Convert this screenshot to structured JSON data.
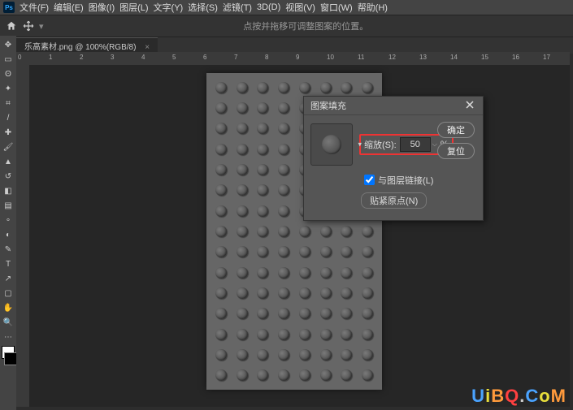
{
  "menubar": {
    "items": [
      "文件(F)",
      "编辑(E)",
      "图像(I)",
      "图层(L)",
      "文字(Y)",
      "选择(S)",
      "滤镜(T)",
      "3D(D)",
      "视图(V)",
      "窗口(W)",
      "帮助(H)"
    ]
  },
  "optbar": {
    "hint": "点按并拖移可调整图案的位置。"
  },
  "tab": {
    "label": "乐高素材.png @ 100%(RGB/8)"
  },
  "ruler": {
    "marks": [
      "0",
      "1",
      "2",
      "3",
      "4",
      "5",
      "6",
      "7",
      "8",
      "9",
      "10",
      "11",
      "12",
      "13",
      "14",
      "15",
      "16",
      "17"
    ]
  },
  "dialog": {
    "title": "图案填充",
    "scale_label": "缩放(S):",
    "scale_value": "50",
    "scale_unit": "%",
    "link_label": "与图层链接(L)",
    "link_checked": true,
    "snap_label": "贴紧原点(N)",
    "ok": "确定",
    "reset": "复位"
  },
  "brand": {
    "u": "U",
    "i": "i",
    "b": "B",
    "q": "Q",
    "dot": ".",
    "c": "C",
    "o": "o",
    "m": "M"
  },
  "chart_data": null
}
